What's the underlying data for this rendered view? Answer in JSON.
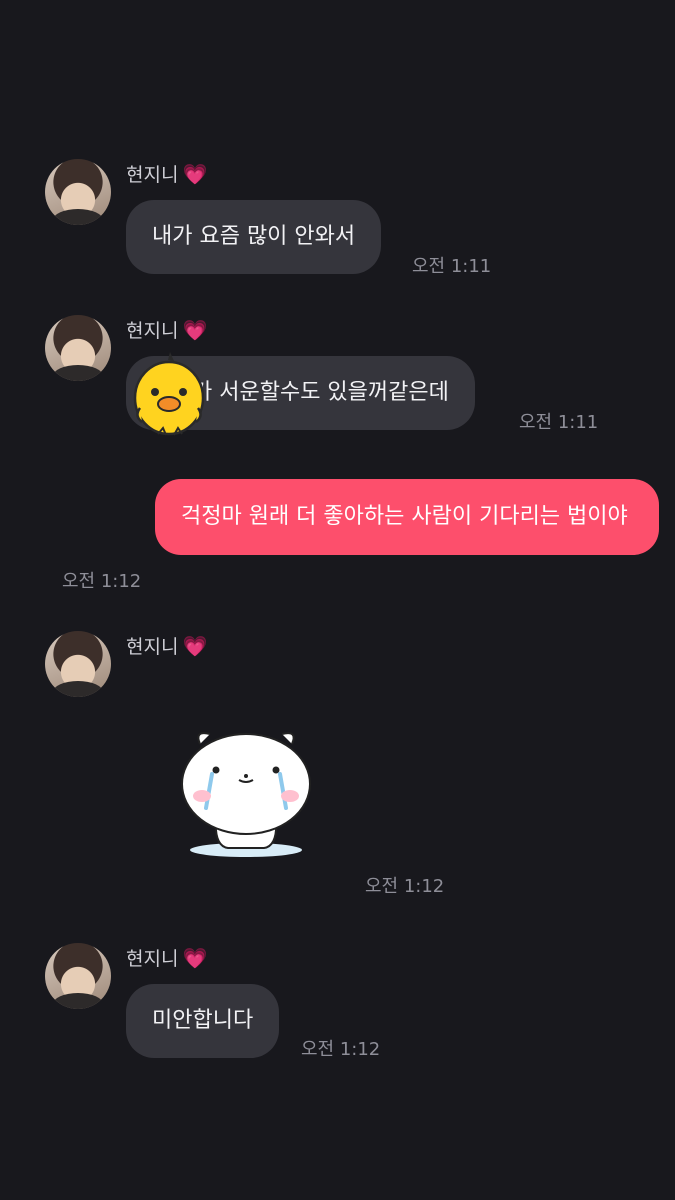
{
  "messages": [
    {
      "sender": "현지니",
      "text": "내가 요즘 많이 안와서",
      "time": "오전 1:11"
    },
    {
      "sender": "현지니",
      "text": "가 서운할수도 있을꺼같은데",
      "time": "오전 1:11"
    },
    {
      "text": "걱정마 원래 더 좋아하는 사람이 기다리는 법이야",
      "time": "오전 1:12"
    },
    {
      "sender": "현지니",
      "time": "오전 1:12"
    },
    {
      "sender": "현지니",
      "text": "미안합니다",
      "time": "오전 1:12"
    }
  ],
  "icons": {
    "heart": "heart-icon",
    "chick": "chick-sticker",
    "crying_bear": "crying-bear-emoticon"
  },
  "colors": {
    "background": "#18181d",
    "incoming_bubble": "#35353c",
    "outgoing_bubble": "#fd4f6c",
    "heart": "#ff4fa3"
  }
}
